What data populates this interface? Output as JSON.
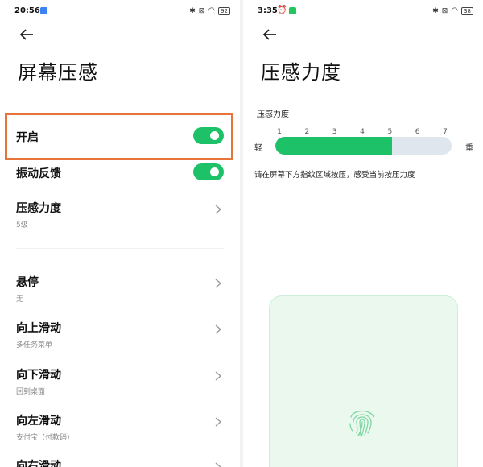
{
  "left": {
    "status": {
      "time": "20:56",
      "battery": "92"
    },
    "title": "屏幕压感",
    "items": [
      {
        "label": "开启",
        "toggle": true
      },
      {
        "label": "振动反馈",
        "toggle": true
      },
      {
        "label": "压感力度",
        "sub": "5级"
      },
      {
        "label": "悬停",
        "sub": "无"
      },
      {
        "label": "向上滑动",
        "sub": "多任务菜单"
      },
      {
        "label": "向下滑动",
        "sub": "回到桌面"
      },
      {
        "label": "向左滑动",
        "sub": "支付宝（付款码）"
      },
      {
        "label": "向右滑动"
      }
    ]
  },
  "right": {
    "status": {
      "time": "3:35",
      "battery": "38"
    },
    "title": "压感力度",
    "slider": {
      "label": "压感力度",
      "ticks": [
        "1",
        "2",
        "3",
        "4",
        "5",
        "6",
        "7"
      ],
      "min_label": "轻",
      "max_label": "重",
      "value": 5,
      "max": 7
    },
    "hint": "请在屏幕下方指纹区域按压，感受当前按压力度"
  },
  "colors": {
    "accent": "#1dc268",
    "highlight": "#e8743b",
    "track": "#e0e6ee",
    "fp_bg": "#eaf8ee"
  },
  "icons": [
    "back-arrow-icon",
    "chevron-right-icon",
    "bluetooth-icon",
    "wifi-icon",
    "battery-icon",
    "fingerprint-icon"
  ]
}
